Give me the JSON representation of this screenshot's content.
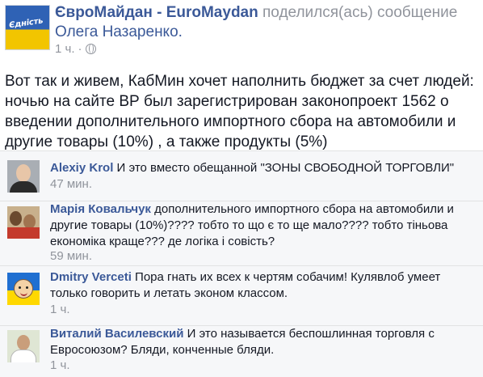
{
  "post": {
    "page_logo_text": "Єдність",
    "author": "ЄвроМайдан - EuroMaydan",
    "action": " поделился(ась) сообщение",
    "shared_from": "Олега Назаренко.",
    "time": "1 ч.",
    "separator": "·",
    "privacy_icon": "globe-icon",
    "body": "Вот так и живем, КабМин хочет наполнить бюджет за счет людей: ночью на сайте ВР был зарегистрирован законопроект 1562 о введении дополнительного импортного сбора на автомобили и другие товары (10%) , а также продукты (5%)"
  },
  "comments": [
    {
      "author": "Alexiy Krol",
      "text": " И это вместо обещанной \"ЗОНЫ СВОБОДНОЙ ТОРГОВЛИ\"",
      "time": "47 мин."
    },
    {
      "author": "Марія Ковальчук",
      "text": " дополнительного импортного сбора на автомобили и другие товары (10%)???? тобто то що є то ще мало???? тобто тіньова економіка краще??? де логіка і совість?",
      "time": "59 мин."
    },
    {
      "author": "Dmitry Verceti",
      "text": " Пора гнать их всех к чертям собачим! Кулявлоб умеет только говорить и летать эконом классом.",
      "time": "1 ч."
    },
    {
      "author": "Виталий Василевский",
      "text": " И это называется беспошлинная торговля с Евросоюзом? Бляди, конченные бляди.",
      "time": "1 ч."
    }
  ],
  "colors": {
    "link": "#3b5998",
    "meta": "#90949c",
    "comment_bg": "#f6f7f9"
  }
}
